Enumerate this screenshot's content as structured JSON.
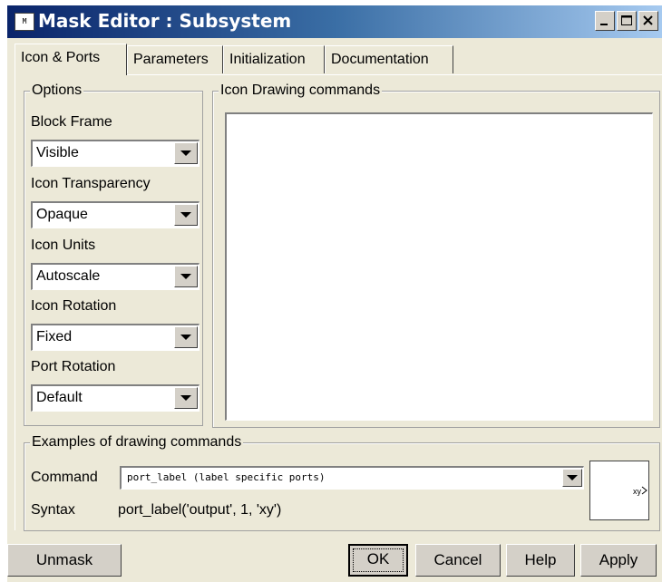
{
  "window": {
    "app_icon_text": "M",
    "title": "Mask Editor : Subsystem"
  },
  "tabs": [
    {
      "label": "Icon & Ports",
      "active": true
    },
    {
      "label": "Parameters",
      "active": false
    },
    {
      "label": "Initialization",
      "active": false
    },
    {
      "label": "Documentation",
      "active": false
    }
  ],
  "options": {
    "legend": "Options",
    "block_frame": {
      "label": "Block Frame",
      "value": "Visible"
    },
    "icon_transparency": {
      "label": "Icon Transparency",
      "value": "Opaque"
    },
    "icon_units": {
      "label": "Icon Units",
      "value": "Autoscale"
    },
    "icon_rotation": {
      "label": "Icon Rotation",
      "value": "Fixed"
    },
    "port_rotation": {
      "label": "Port Rotation",
      "value": "Default"
    }
  },
  "drawing": {
    "legend": "Icon Drawing commands",
    "value": ""
  },
  "examples": {
    "legend": "Examples of drawing commands",
    "command_label": "Command",
    "command_value": "port_label (label specific ports)",
    "syntax_label": "Syntax",
    "syntax_value": "port_label('output', 1, 'xy')",
    "preview_label": "xy"
  },
  "buttons": {
    "unmask": "Unmask",
    "ok": "OK",
    "cancel": "Cancel",
    "help": "Help",
    "apply": "Apply"
  },
  "colors": {
    "dialog_bg": "#ece9d8",
    "title_start": "#0a246a",
    "title_end": "#a6caf0"
  }
}
